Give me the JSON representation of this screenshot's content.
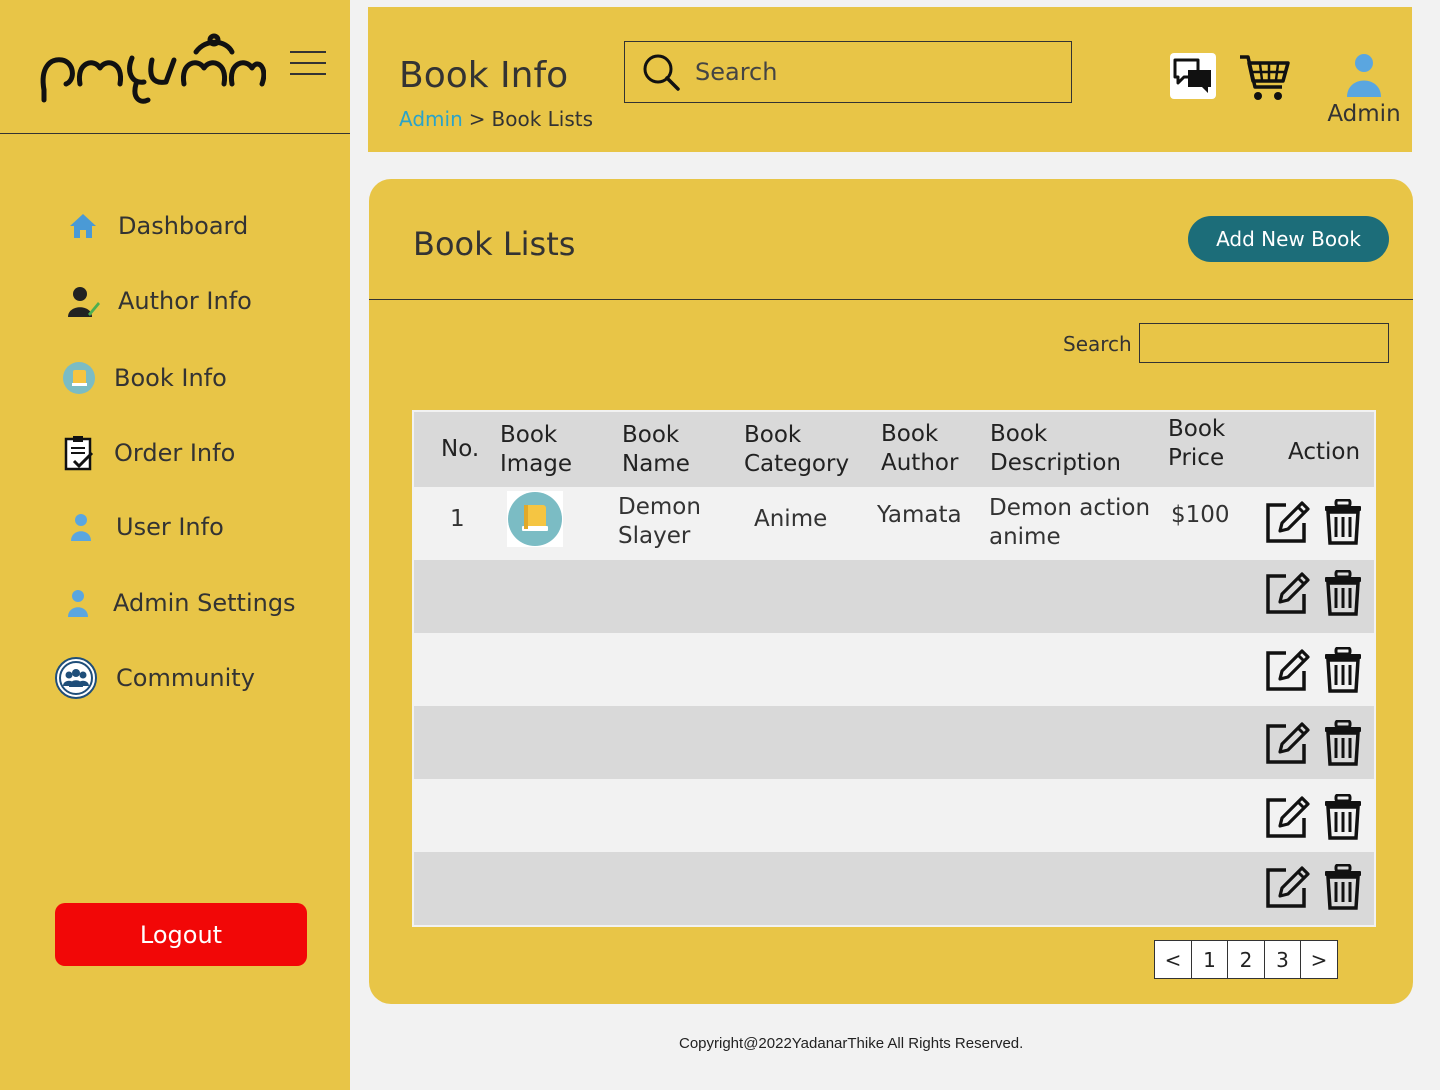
{
  "brand": {
    "logo_text": "ရတနာသိုက်"
  },
  "sidebar": {
    "items": [
      {
        "label": "Dashboard",
        "icon": "home-icon"
      },
      {
        "label": "Author Info",
        "icon": "author-icon"
      },
      {
        "label": "Book Info",
        "icon": "book-icon"
      },
      {
        "label": "Order Info",
        "icon": "clipboard-check-icon"
      },
      {
        "label": "User  Info",
        "icon": "user-icon"
      },
      {
        "label": "Admin Settings",
        "icon": "admin-user-icon"
      },
      {
        "label": "Community",
        "icon": "community-icon"
      }
    ],
    "logout_label": "Logout"
  },
  "header": {
    "title": "Book Info",
    "breadcrumb": {
      "root": "Admin",
      "separator": ">",
      "current": "Book Lists"
    },
    "search_placeholder": "Search",
    "user_label": "Admin"
  },
  "panel": {
    "title": "Book Lists",
    "add_button_label": "Add New Book",
    "search_label": "Search"
  },
  "table": {
    "headers": {
      "no": "No.",
      "image_1": "Book",
      "image_2": "Image",
      "name_1": "Book",
      "name_2": "Name",
      "category_1": "Book",
      "category_2": "Category",
      "author_1": "Book",
      "author_2": "Author",
      "description_1": "Book",
      "description_2": "Description",
      "price_1": "Book",
      "price_2": "Price",
      "action": "Action"
    },
    "rows": [
      {
        "no": "1",
        "name_1": "Demon",
        "name_2": "Slayer",
        "category": "Anime",
        "author": "Yamata",
        "description_1": "Demon action",
        "description_2": "anime",
        "price": "$100"
      }
    ]
  },
  "pagination": {
    "prev": "<",
    "pages": [
      "1",
      "2",
      "3"
    ],
    "next": ">"
  },
  "footer": {
    "copyright": "Copyright@2022YadanarThike All Rights Reserved."
  },
  "colors": {
    "sidebar_bg": "#e8c547",
    "accent_teal": "#1c6d79",
    "logout_red": "#f20707",
    "link_blue": "#2aa3c9",
    "page_bg": "#f2f2f2"
  }
}
